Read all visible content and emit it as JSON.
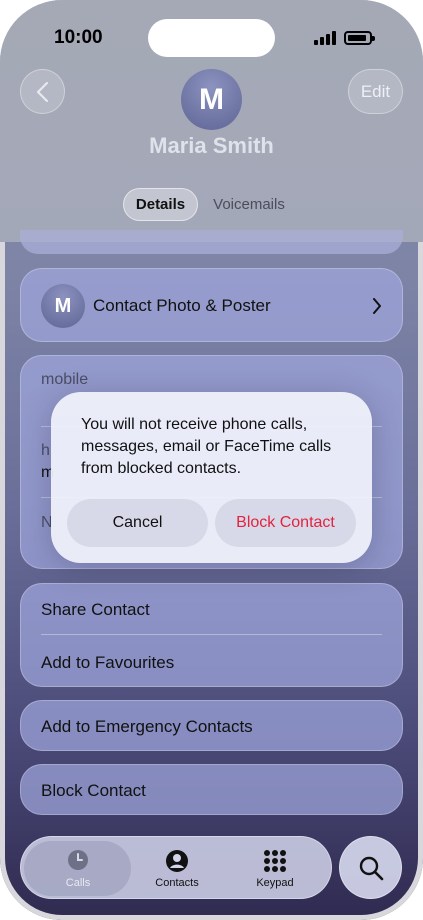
{
  "status_bar": {
    "time": "10:00"
  },
  "header": {
    "edit_label": "Edit",
    "avatar_initial": "M",
    "contact_name": "Maria Smith",
    "tabs": [
      {
        "label": "Details",
        "selected": true
      },
      {
        "label": "Voicemails",
        "selected": false
      }
    ]
  },
  "contact_photo_row": {
    "avatar_initial": "M",
    "label": "Contact Photo & Poster"
  },
  "phone_card": {
    "mobile_label": "mobile",
    "partial_label_1": "h",
    "partial_label_2": "m",
    "partial_label_3": "N"
  },
  "actions": {
    "share_contact": "Share Contact",
    "add_to_favourites": "Add to Favourites",
    "add_to_emergency": "Add to Emergency Contacts",
    "block_contact": "Block Contact"
  },
  "alert": {
    "message": "You will not receive phone calls, messages, email or FaceTime calls from blocked contacts.",
    "cancel_label": "Cancel",
    "confirm_label": "Block Contact",
    "confirm_color": "#e3233f"
  },
  "tab_bar": {
    "items": [
      {
        "label": "Calls",
        "icon": "clock-icon",
        "active": true
      },
      {
        "label": "Contacts",
        "icon": "person-circle-icon",
        "active": false
      },
      {
        "label": "Keypad",
        "icon": "keypad-icon",
        "active": false
      }
    ],
    "search_icon": "search-icon"
  }
}
